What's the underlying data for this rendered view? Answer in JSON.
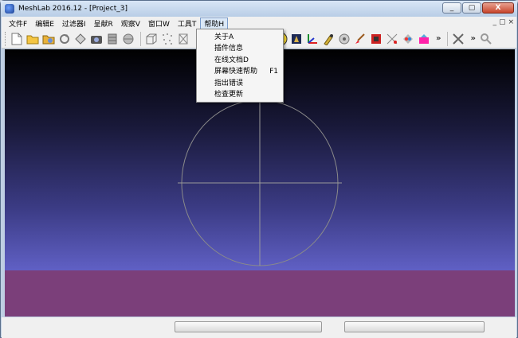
{
  "window": {
    "title": "MeshLab 2016.12 - [Project_3]",
    "controls": [
      "_",
      "▢",
      "X"
    ]
  },
  "menubar": {
    "items": [
      {
        "label": "文件F"
      },
      {
        "label": "编辑E"
      },
      {
        "label": "过滤器I"
      },
      {
        "label": "呈献R"
      },
      {
        "label": "观察V"
      },
      {
        "label": "窗口W"
      },
      {
        "label": "工具T"
      },
      {
        "label": "帮助H"
      }
    ],
    "mdi_controls": [
      "_",
      "▢",
      "×"
    ]
  },
  "help_menu": {
    "items": [
      {
        "label": "关于A",
        "shortcut": ""
      },
      {
        "label": "插件信息",
        "shortcut": ""
      },
      {
        "label": "在线文档D",
        "shortcut": ""
      },
      {
        "label": "屏幕快速帮助",
        "shortcut": "F1"
      },
      {
        "label": "指出错误",
        "shortcut": ""
      },
      {
        "label": "检查更新",
        "shortcut": ""
      }
    ]
  },
  "toolbar": {
    "overflow_glyph": "»",
    "annotate_letter": "A",
    "icons": [
      "new-project-icon",
      "open-project-icon",
      "open-mesh-icon",
      "reload-icon",
      "import-icon",
      "snapshot-icon",
      "layers-icon",
      "save-icon",
      "bounding-box-icon",
      "points-icon",
      "wireframe-icon",
      "light-icon",
      "annotate-icon",
      "texture-icon",
      "axis-icon",
      "pick-icon",
      "measure-icon",
      "paint-icon",
      "select-faces-icon",
      "select-vertices-icon",
      "color-icon",
      "tools-icon",
      "search-icon"
    ]
  },
  "colors": {
    "viewport_top": "#000000",
    "viewport_bottom": "#6a6ad0",
    "ground": "#7b3f7a",
    "trackball": "#9a9a9a"
  }
}
